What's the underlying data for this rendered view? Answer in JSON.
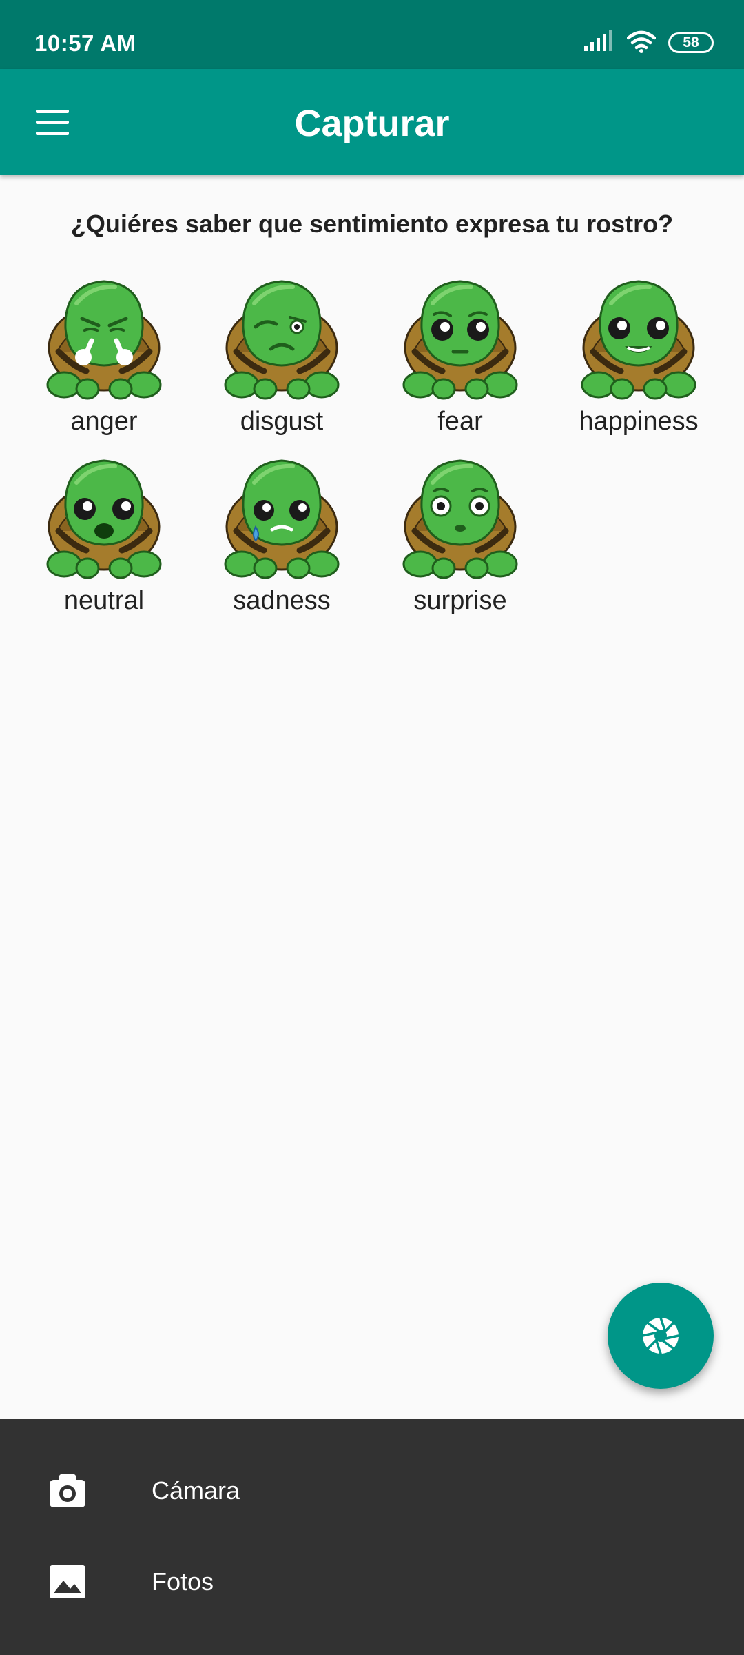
{
  "status_bar": {
    "time": "10:57 AM",
    "battery": "58",
    "icons": [
      "signal-icon",
      "wifi-icon",
      "battery-icon"
    ]
  },
  "app_bar": {
    "title": "Capturar",
    "menu_icon": "menu-icon"
  },
  "prompt": "¿Quiéres saber que sentimiento expresa tu rostro?",
  "emotions": [
    {
      "label": "anger"
    },
    {
      "label": "disgust"
    },
    {
      "label": "fear"
    },
    {
      "label": "happiness"
    },
    {
      "label": "neutral"
    },
    {
      "label": "sadness"
    },
    {
      "label": "surprise"
    }
  ],
  "fab": {
    "icon": "camera-shutter-icon"
  },
  "bottom_sheet": {
    "items": [
      {
        "label": "Cámara",
        "icon": "camera-icon"
      },
      {
        "label": "Fotos",
        "icon": "image-icon"
      }
    ]
  },
  "colors": {
    "primary": "#009688",
    "primary_dark": "#00796b",
    "sheet_background": "#323232",
    "turtle_green": "#4cb848",
    "turtle_shell": "#a57c2c"
  }
}
